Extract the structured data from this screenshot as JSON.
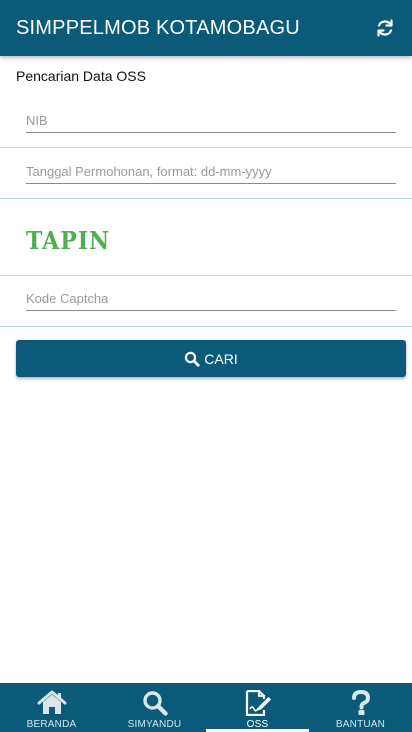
{
  "appbar": {
    "title": "SIMPPELMOB KOTAMOBAGU",
    "refresh_icon": "refresh-icon"
  },
  "section": {
    "title": "Pencarian Data OSS"
  },
  "form": {
    "nib": {
      "placeholder": "NIB",
      "value": ""
    },
    "tanggal": {
      "placeholder": "Tanggal Permohonan, format: dd-mm-yyyy",
      "value": ""
    },
    "captcha_image_text": "TAPIN",
    "captcha": {
      "placeholder": "Kode Captcha",
      "value": ""
    },
    "submit_label": "CARI",
    "submit_icon": "search-icon"
  },
  "bottom_nav": {
    "items": [
      {
        "label": "BERANDA",
        "icon": "home-icon"
      },
      {
        "label": "SIMYANDU",
        "icon": "search-icon"
      },
      {
        "label": "OSS",
        "icon": "sign-document-icon",
        "active": true
      },
      {
        "label": "BANTUAN",
        "icon": "question-icon"
      }
    ]
  },
  "colors": {
    "primary": "#0b5a7a",
    "captcha": "#4caf50",
    "divider": "#b8d8de"
  }
}
